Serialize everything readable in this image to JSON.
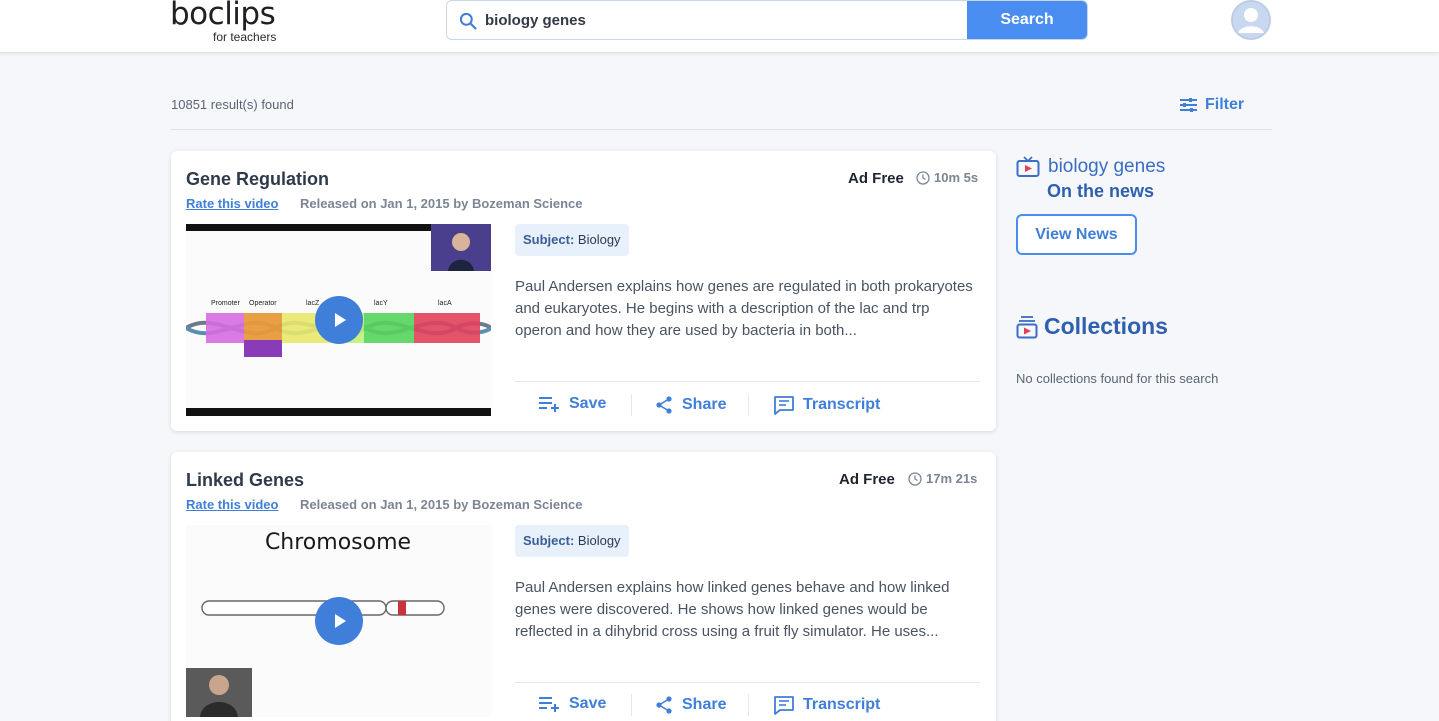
{
  "header": {
    "logo_main": "boclips",
    "logo_sub": "for teachers",
    "search_value": "biology genes",
    "search_button": "Search"
  },
  "results": {
    "count_text": "10851 result(s) found",
    "filter_label": "Filter"
  },
  "videos": [
    {
      "title": "Gene Regulation",
      "ad_free": "Ad Free",
      "duration": "10m 5s",
      "rate_link": "Rate this video",
      "released": "Released on Jan 1, 2015 by Bozeman Science",
      "subject_label": "Subject:",
      "subject_value": "Biology",
      "description": "Paul Andersen explains how genes are regulated in both prokaryotes and eukaryotes. He begins with a description of the lac and trp operon and how they are used by bacteria in both...",
      "thumb_labels": [
        "Promoter",
        "Operator",
        "lacZ",
        "lacY",
        "lacA"
      ],
      "actions": {
        "save": "Save",
        "share": "Share",
        "transcript": "Transcript"
      }
    },
    {
      "title": "Linked Genes",
      "ad_free": "Ad Free",
      "duration": "17m 21s",
      "rate_link": "Rate this video",
      "released": "Released on Jan 1, 2015 by Bozeman Science",
      "subject_label": "Subject:",
      "subject_value": "Biology",
      "description": "Paul Andersen explains how linked genes behave and how linked genes were discovered. He shows how linked genes would be reflected in a dihybrid cross using a fruit fly simulator. He uses...",
      "thumb_title": "Chromosome",
      "actions": {
        "save": "Save",
        "share": "Share",
        "transcript": "Transcript"
      }
    }
  ],
  "sidebar": {
    "news_query": "biology genes",
    "news_sub": "On the news",
    "view_news": "View News",
    "collections_title": "Collections",
    "no_collections": "No collections found for this search"
  },
  "colors": {
    "accent": "#4a8df0",
    "link": "#3f7fd9",
    "heading_blue": "#2f5fae"
  }
}
